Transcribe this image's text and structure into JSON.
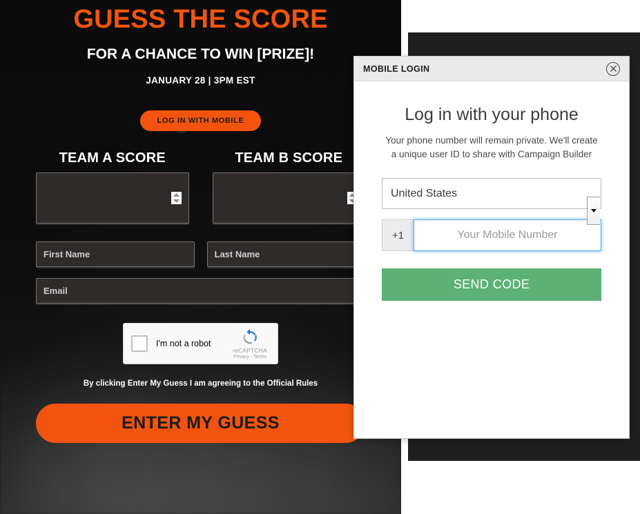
{
  "campaign": {
    "title": "GUESS THE SCORE",
    "subtitle": "FOR A CHANCE TO WIN [PRIZE]!",
    "date": "JANUARY 28 | 3PM EST",
    "login_mobile_button": "LOG IN WITH MOBILE",
    "scores": [
      {
        "label": "TEAM A SCORE",
        "value": "",
        "placeholder": ""
      },
      {
        "label": "TEAM B SCORE",
        "value": "",
        "placeholder": ""
      }
    ],
    "fields": {
      "first_name_placeholder": "First Name",
      "first_name_value": "",
      "last_name_placeholder": "Last Name",
      "last_name_value": "",
      "email_placeholder": "Email",
      "email_value": ""
    },
    "recaptcha": {
      "checkbox_label": "I'm not a robot",
      "brand": "reCAPTCHA",
      "links": "Privacy - Terms"
    },
    "disclaimer": "By clicking Enter My Guess I am agreeing to the Official Rules",
    "submit_button": "ENTER MY GUESS",
    "colors": {
      "accent_orange": "#f2540f",
      "page_background": "#161616",
      "field_background": "#2e2b2a"
    }
  },
  "modal": {
    "header_title": "MOBILE LOGIN",
    "close_icon": "close-circle-icon",
    "heading": "Log in with your phone",
    "description": "Your phone number will remain private. We'll create a unique user ID to share with Campaign Builder",
    "country_selected": "United States",
    "country_options": [
      "United States"
    ],
    "dial_code_prefix": "+1",
    "phone_placeholder": "Your Mobile Number",
    "phone_value": "",
    "send_code_button": "SEND CODE",
    "colors": {
      "header_background": "#eaeaea",
      "send_code_green": "#5cb176",
      "focus_blue": "#4da3f0"
    }
  }
}
